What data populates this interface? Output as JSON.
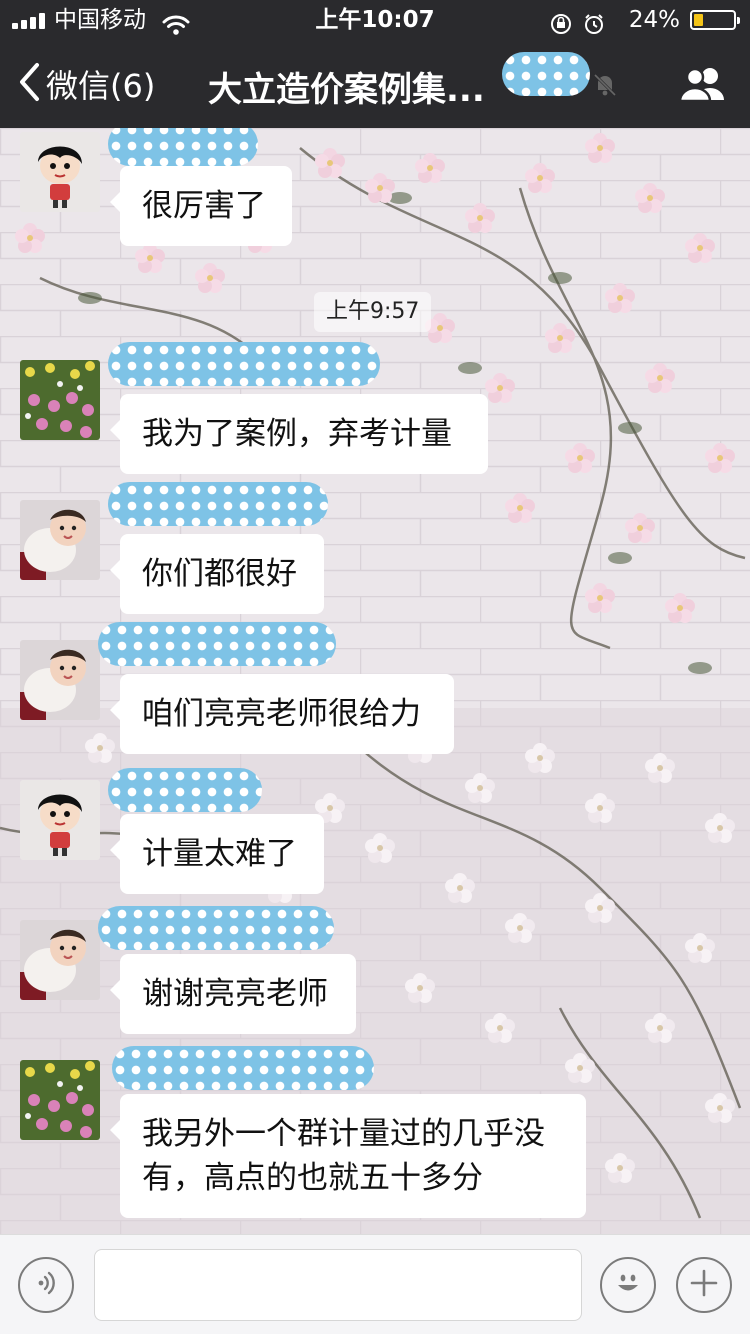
{
  "status_bar": {
    "carrier": "中国移动",
    "time": "上午10:07",
    "battery_percent": "24%",
    "battery_level": 0.24,
    "battery_color": "#f5c518"
  },
  "nav": {
    "back_label": "微信(6)",
    "title": "大立造价案例集...",
    "icons": [
      "chevron-left-icon",
      "mute-bell-icon",
      "group-members-icon"
    ]
  },
  "chat": {
    "timestamp": "上午9:57",
    "messages": [
      {
        "avatar": "cartoon-girl",
        "text_lines": [
          "很厉害了"
        ]
      },
      {
        "avatar": "flower-garden",
        "text_lines": [
          "我为了案例，弃考计量"
        ]
      },
      {
        "avatar": "baby-photo",
        "text_lines": [
          "你们都很好"
        ]
      },
      {
        "avatar": "baby-photo",
        "text_lines": [
          "咱们亮亮老师很给力"
        ]
      },
      {
        "avatar": "cartoon-girl",
        "text_lines": [
          "计量太难了"
        ]
      },
      {
        "avatar": "baby-photo",
        "text_lines": [
          "谢谢亮亮老师"
        ]
      },
      {
        "avatar": "flower-garden",
        "text_lines": [
          "我另外一个群计量过的几乎没",
          "有，高点的也就五十多分"
        ]
      }
    ]
  },
  "input_bar": {
    "icons": [
      "voice-icon",
      "emoji-icon",
      "plus-icon"
    ],
    "input_value": ""
  },
  "colors": {
    "nav_bg": "#2a2a2d",
    "bubble_bg": "#ffffff",
    "redaction_blue": "#7ec3e6"
  }
}
